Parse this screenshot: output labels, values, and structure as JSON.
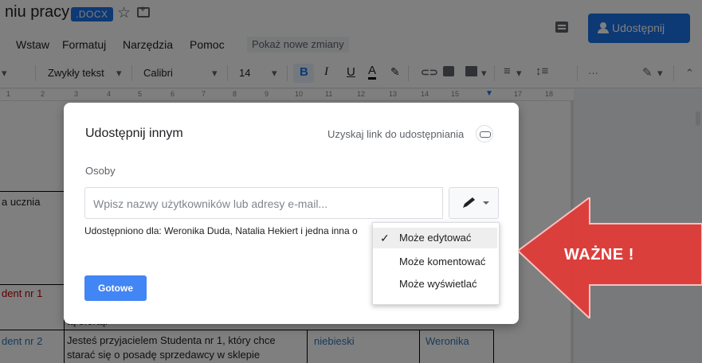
{
  "header": {
    "doc_title": "niu pracy",
    "badge": ".DOCX",
    "menu": [
      "Wstaw",
      "Formatuj",
      "Narzędzia",
      "Pomoc"
    ],
    "changes_label": "Pokaż nowe zmiany",
    "share_label": "Udostępnij"
  },
  "toolbar": {
    "style": "Zwykły tekst",
    "font": "Calibri",
    "size": "14",
    "bold": "B",
    "italic": "I",
    "underline": "U",
    "text_color": "A",
    "more": "···"
  },
  "ruler": {
    "numbers": [
      "1",
      "2",
      "3",
      "4",
      "5",
      "6",
      "7",
      "8",
      "9",
      "10",
      "11",
      "12",
      "13",
      "14",
      "15",
      "17",
      "18"
    ]
  },
  "document": {
    "cell_1": "a ucznia",
    "cell_2": "dent nr 1",
    "cell_3": "tą ofertą.",
    "cell_4": "dent nr 2",
    "cell_5_line1": "Jesteś przyjacielem Studenta nr 1, który chce",
    "cell_5_line2": "starać się  o posadę sprzedawcy w sklepie",
    "cell_6": "niebieski",
    "cell_7": "Weronika"
  },
  "dialog": {
    "title": "Udostępnij innym",
    "get_link": "Uzyskaj link do udostępniania",
    "people_label": "Osoby",
    "input_placeholder": "Wpisz nazwy użytkowników lub adresy e-mail...",
    "shared_with": "Udostępniono dla: Weronika Duda, Natalia Hekiert i jedna inna o",
    "done_label": "Gotowe"
  },
  "permissions": {
    "options": [
      "Może edytować",
      "Może komentować",
      "Może wyświetlać"
    ],
    "selected": "Może edytować"
  },
  "annotation": {
    "text": "WAŻNE !",
    "color": "#e53935"
  }
}
